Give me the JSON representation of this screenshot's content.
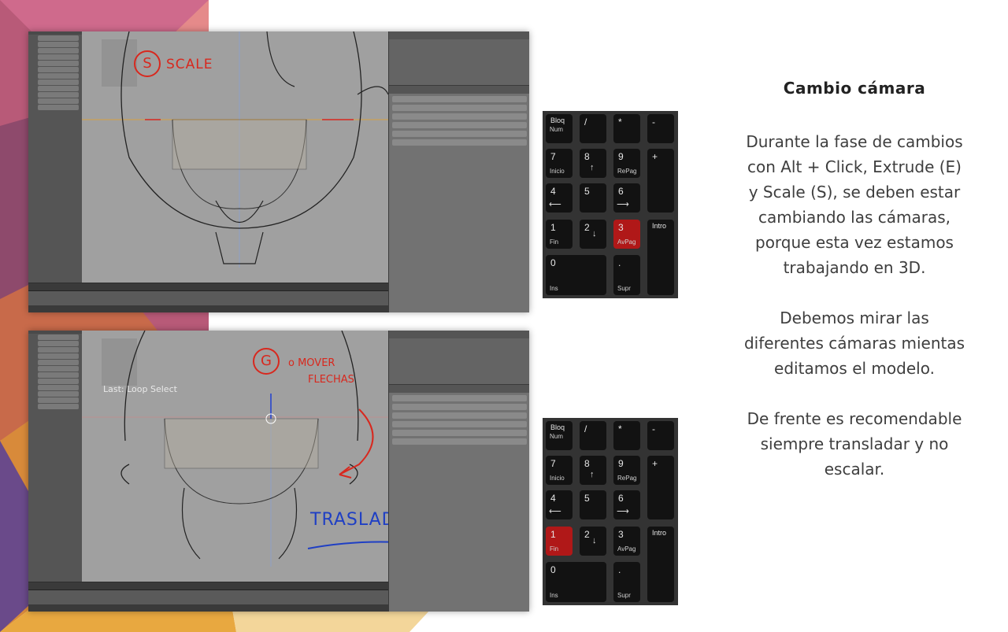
{
  "slide": {
    "heading": "Cambio cámara",
    "paragraphs": [
      "Durante la fase de cambios con Alt + Click, Extrude (E)  y Scale (S), se deben estar cambiando las cámaras, porque esta vez estamos trabajando en 3D.",
      "Debemos mirar las diferentes cámaras mientas editamos el modelo.",
      "De frente es recomendable siempre transladar y no escalar."
    ]
  },
  "screenshot_top": {
    "annotation_key": "S",
    "annotation_text": "SCALE",
    "highlighted_key": "3"
  },
  "screenshot_bottom": {
    "overlay_text": "Last: Loop Select",
    "annotation_key": "G",
    "annotation_text_1": "o MOVER",
    "annotation_text_2": "FLECHAS",
    "annotation_text_3": "TRASLADAR",
    "highlighted_key": "1"
  },
  "keypad": {
    "keys": [
      {
        "main": "Bloq",
        "sub": "Num"
      },
      {
        "main": "/",
        "sub": ""
      },
      {
        "main": "*",
        "sub": ""
      },
      {
        "main": "-",
        "sub": ""
      },
      {
        "main": "7",
        "sub": "Inicio"
      },
      {
        "main": "8",
        "sub": ""
      },
      {
        "main": "9",
        "sub": "RePag"
      },
      {
        "main": "+",
        "sub": ""
      },
      {
        "main": "4",
        "sub": ""
      },
      {
        "main": "5",
        "sub": ""
      },
      {
        "main": "6",
        "sub": ""
      },
      {
        "main": "1",
        "sub": "Fin"
      },
      {
        "main": "2",
        "sub": ""
      },
      {
        "main": "3",
        "sub": "AvPag"
      },
      {
        "main": "Intro",
        "sub": ""
      },
      {
        "main": "0",
        "sub": "Ins"
      },
      {
        "main": ".",
        "sub": "Supr"
      }
    ]
  },
  "colors": {
    "highlight_key": "#b01818",
    "annotation_red": "#d8281e",
    "annotation_blue": "#1f3fc4"
  }
}
